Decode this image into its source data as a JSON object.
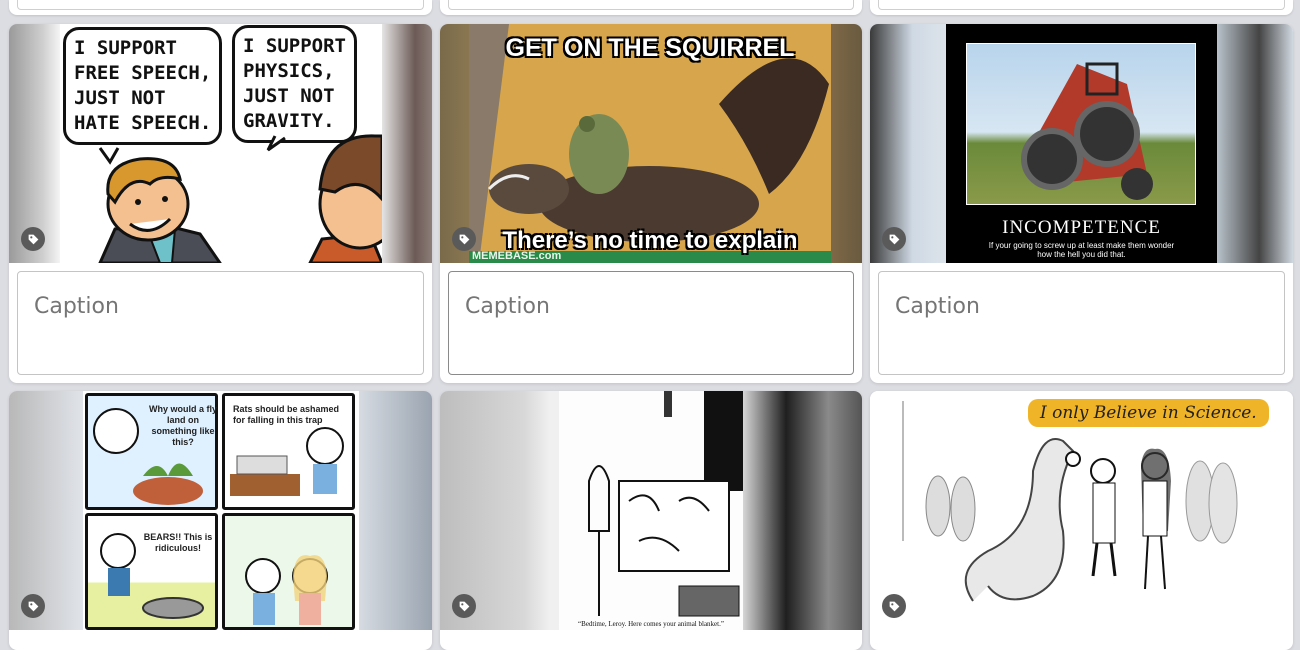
{
  "caption_placeholder": "Caption",
  "cards": [
    {
      "meme": "comic-free-speech",
      "bubbles": [
        "I SUPPORT\nFREE SPEECH,\nJUST NOT\nHATE SPEECH.",
        "I SUPPORT\nPHYSICS,\nJUST NOT\nGRAVITY."
      ],
      "caption_value": ""
    },
    {
      "meme": "squirrel",
      "top_text": "GET ON THE SQUIRREL",
      "bottom_text": "There’s no time to explain",
      "watermark": "MEMEBASE.com",
      "caption_value": ""
    },
    {
      "meme": "incompetence",
      "title": "INCOMPETENCE",
      "subtitle": "If your going to screw up at least make them wonder how the hell you did that.",
      "caption_value": ""
    },
    {
      "meme": "flytrap-comic",
      "panels": [
        "Why would a fly land on something like this?",
        "Rats should be ashamed for falling in this trap",
        "BEARS!! This is ridiculous!",
        ""
      ],
      "caption_value": ""
    },
    {
      "meme": "animal-blanket",
      "caption": "“Bedtime, Leroy. Here comes your animal blanket.”",
      "caption_value": ""
    },
    {
      "meme": "believe-in-science",
      "bubble": "I only Believe in Science.",
      "caption_value": ""
    }
  ],
  "colors": {
    "page_bg": "#dcdde2",
    "card_bg": "#ffffff",
    "tag_button": "#5a5a5a",
    "science_bubble": "#f0b429"
  },
  "icons": {
    "tag": "tag-icon"
  }
}
